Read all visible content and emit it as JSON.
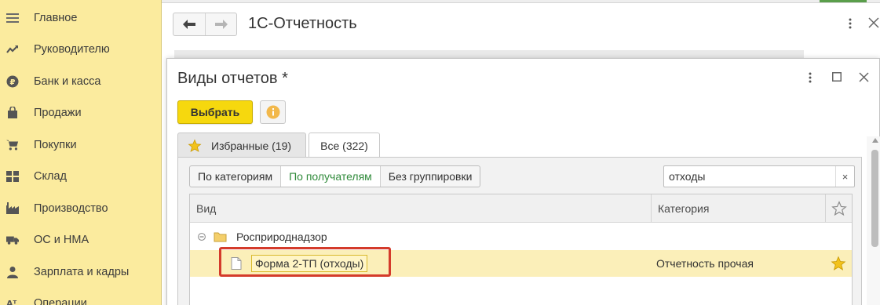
{
  "sidebar": {
    "items": [
      {
        "label": "Главное",
        "icon": "menu-icon"
      },
      {
        "label": "Руководителю",
        "icon": "trend-icon"
      },
      {
        "label": "Банк и касса",
        "icon": "ruble-coin-icon"
      },
      {
        "label": "Продажи",
        "icon": "shopping-bag-icon"
      },
      {
        "label": "Покупки",
        "icon": "cart-icon"
      },
      {
        "label": "Склад",
        "icon": "warehouse-icon"
      },
      {
        "label": "Производство",
        "icon": "factory-icon"
      },
      {
        "label": "ОС и НМА",
        "icon": "truck-icon"
      },
      {
        "label": "Зарплата и кадры",
        "icon": "person-icon"
      },
      {
        "label": "Операции",
        "icon": "operations-icon"
      }
    ]
  },
  "header": {
    "title": "1С-Отчетность"
  },
  "dialog": {
    "title": "Виды отчетов *",
    "select_button": "Выбрать",
    "tabs": [
      {
        "label": "Избранные (19)"
      },
      {
        "label": "Все (322)"
      }
    ],
    "grouping": [
      {
        "label": "По категориям"
      },
      {
        "label": "По получателям"
      },
      {
        "label": "Без группировки"
      }
    ],
    "search": {
      "value": "отходы",
      "clear": "×"
    },
    "table": {
      "columns": [
        "Вид",
        "Категория"
      ],
      "group_row": {
        "label": "Росприроднадзор"
      },
      "rows": [
        {
          "name": "Форма 2-ТП (отходы)",
          "category": "Отчетность прочая",
          "favorite": true
        }
      ]
    }
  },
  "colors": {
    "sidebar_bg": "#fbeb9e",
    "accent_yellow": "#f6d80e",
    "selected_row": "#fbefb9",
    "active_grouping": "#2f8a3a",
    "highlight_red": "#d43b2b",
    "star": "#f2c21b"
  }
}
